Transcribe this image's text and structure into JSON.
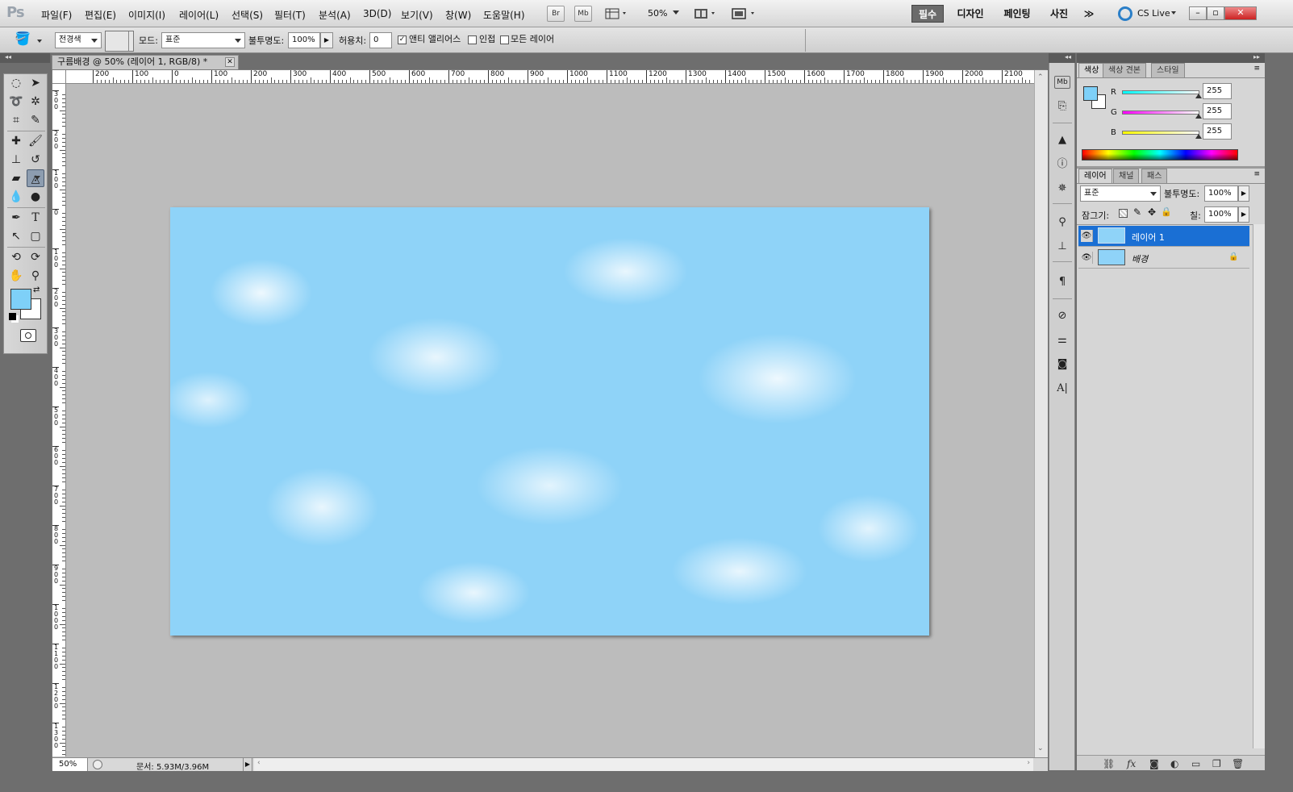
{
  "app": {
    "logo": "Ps"
  },
  "menu": [
    "파일(F)",
    "편집(E)",
    "이미지(I)",
    "레이어(L)",
    "선택(S)",
    "필터(T)",
    "분석(A)",
    "3D(D)",
    "보기(V)",
    "창(W)",
    "도움말(H)"
  ],
  "appbar": {
    "br": "Br",
    "mb": "Mb",
    "zoom": "50%"
  },
  "workspaces": [
    "필수",
    "디자인",
    "페인팅",
    "사진"
  ],
  "more": "≫",
  "cslive": "CS Live",
  "options": {
    "fill_source": "전경색",
    "mode_label": "모드:",
    "mode_value": "표준",
    "opacity_label": "불투명도:",
    "opacity_value": "100%",
    "tolerance_label": "허용치:",
    "tolerance_value": "0",
    "antialias_label": "앤티 앨리어스",
    "contiguous_label": "인접",
    "all_layers_label": "모든 레이어"
  },
  "document": {
    "tab_title": "구름배경 @ 50% (레이어 1, RGB/8) *",
    "hruler_ticks": [
      "200",
      "100",
      "0",
      "100",
      "200",
      "300",
      "400",
      "500",
      "600",
      "700",
      "800",
      "900",
      "1000",
      "1100",
      "1200",
      "1300",
      "1400",
      "1500",
      "1600",
      "1700",
      "1800",
      "1900",
      "2000",
      "2100"
    ],
    "vruler_ticks": [
      "300",
      "200",
      "100",
      "0",
      "100",
      "200",
      "300",
      "400",
      "500",
      "600",
      "700",
      "800",
      "900",
      "1000",
      "1100",
      "1200",
      "1300"
    ],
    "zoom": "50%",
    "doc_info": "문서: 5.93M/3.96M"
  },
  "color_panel": {
    "tabs": [
      "색상",
      "색상 견본",
      "스타일"
    ],
    "labels": {
      "r": "R",
      "g": "G",
      "b": "B"
    },
    "r": "255",
    "g": "255",
    "b": "255",
    "fg_color": "#7ed0f8",
    "bg_color": "#ffffff"
  },
  "layers_panel": {
    "tabs": [
      "레이어",
      "채널",
      "패스"
    ],
    "blend_mode": "표준",
    "opacity_label": "불투명도:",
    "opacity_value": "100%",
    "lock_label": "잠그기:",
    "fill_label": "칠:",
    "fill_value": "100%",
    "layers": [
      {
        "name": "레이어 1",
        "selected": true
      },
      {
        "name": "배경",
        "selected": false
      }
    ]
  },
  "colors": {
    "accent": "#1a6fd4",
    "canvas_sky": "#8fd3f8"
  }
}
